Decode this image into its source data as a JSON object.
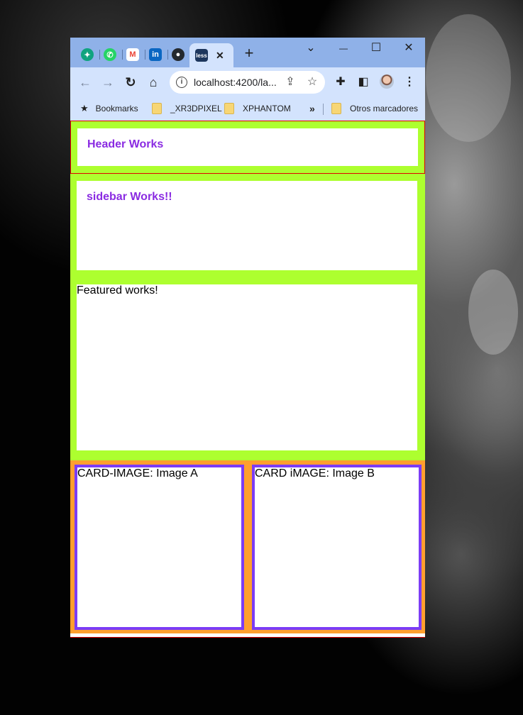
{
  "browser": {
    "tabs": [
      {
        "name": "chatgpt",
        "color": "#10a37f"
      },
      {
        "name": "whatsapp",
        "color": "#25d366"
      },
      {
        "name": "gmail",
        "color": "#ea4335"
      },
      {
        "name": "linkedin",
        "color": "#0a66c2"
      },
      {
        "name": "github",
        "color": "#24292f"
      },
      {
        "name": "less",
        "label": "less"
      }
    ],
    "active_tab_close": "✕",
    "new_tab": "+",
    "window_controls": {
      "dropdown": "⌄",
      "minimize": "—",
      "maximize": "☐",
      "close": "✕"
    },
    "address": "localhost:4200/la...",
    "bookmarks": {
      "main": "Bookmarks",
      "items": [
        "_XR3DPIXEL",
        "XPHANTOM"
      ],
      "overflow": "»",
      "other": "Otros marcadores"
    }
  },
  "app": {
    "header_title": "Header Works",
    "sidebar_title": "sidebar Works!!",
    "featured_text": "Featured works!",
    "card_a": "CARD-IMAGE: Image A",
    "card_b": "CARD iMAGE: Image B",
    "colors": {
      "green": "#adff2f",
      "purple": "#8a2be2",
      "orange": "#ff9f2e",
      "card_border": "#7b3cf5",
      "red_border": "#e00000"
    }
  }
}
